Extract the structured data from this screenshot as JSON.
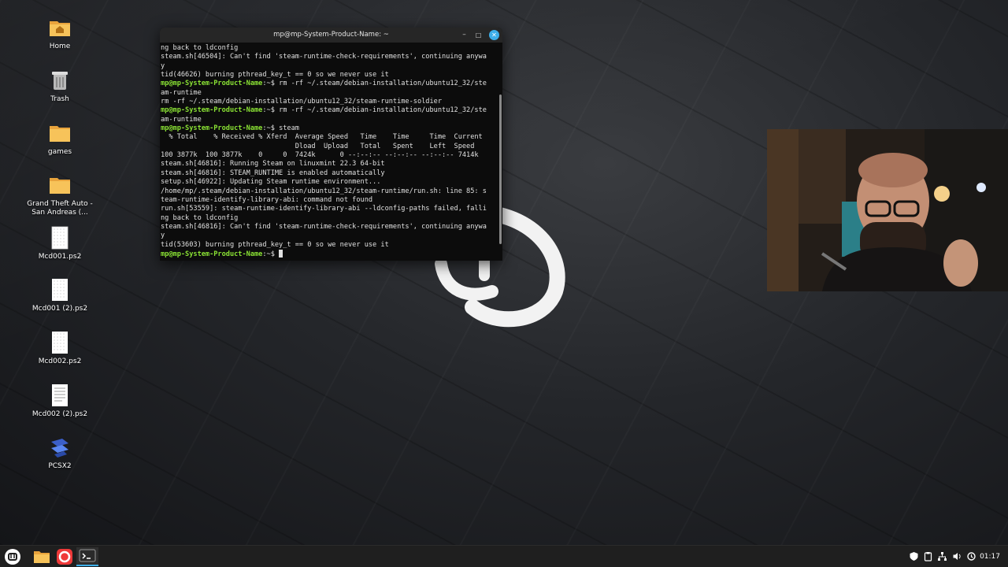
{
  "desktop": {
    "icons": [
      {
        "label": "Home",
        "icon": "home-folder-icon"
      },
      {
        "label": "Trash",
        "icon": "trash-icon"
      },
      {
        "label": "games",
        "icon": "folder-icon"
      },
      {
        "label": "Grand Theft Auto - San Andreas (...",
        "icon": "folder-icon"
      },
      {
        "label": "Mcd001.ps2",
        "icon": "file-icon"
      },
      {
        "label": "Mcd001 (2).ps2",
        "icon": "file-icon"
      },
      {
        "label": "Mcd002.ps2",
        "icon": "file-icon"
      },
      {
        "label": "Mcd002 (2).ps2",
        "icon": "text-file-icon"
      },
      {
        "label": "PCSX2",
        "icon": "pcsx2-icon"
      }
    ]
  },
  "terminal": {
    "title": "mp@mp-System-Product-Name: ~",
    "prompt_user": "mp@mp-System-Product-Name",
    "prompt_suffix": ":~$ ",
    "lines": [
      {
        "text": "ng back to ldconfig"
      },
      {
        "text": "steam.sh[46504]: Can't find 'steam-runtime-check-requirements', continuing anywa"
      },
      {
        "text": "y"
      },
      {
        "text": "tid(46626) burning pthread_key_t == 0 so we never use it"
      },
      {
        "prompt": true,
        "text": "rm -rf ~/.steam/debian-installation/ubuntu12_32/ste"
      },
      {
        "text": "am-runtime"
      },
      {
        "text": "rm -rf ~/.steam/debian-installation/ubuntu12_32/steam-runtime-soldier"
      },
      {
        "prompt": true,
        "text": "rm -rf ~/.steam/debian-installation/ubuntu12_32/ste"
      },
      {
        "text": "am-runtime"
      },
      {
        "prompt": true,
        "text": "steam"
      },
      {
        "text": "  % Total    % Received % Xferd  Average Speed   Time    Time     Time  Current"
      },
      {
        "text": "                                 Dload  Upload   Total   Spent    Left  Speed"
      },
      {
        "text": "100 3877k  100 3877k    0     0  7424k      0 --:--:-- --:--:-- --:--:-- 7414k"
      },
      {
        "text": "steam.sh[46816]: Running Steam on linuxmint 22.3 64-bit"
      },
      {
        "text": "steam.sh[46816]: STEAM_RUNTIME is enabled automatically"
      },
      {
        "text": "setup.sh[46922]: Updating Steam runtime environment..."
      },
      {
        "text": "/home/mp/.steam/debian-installation/ubuntu12_32/steam-runtime/run.sh: line 85: s"
      },
      {
        "text": "team-runtime-identify-library-abi: command not found"
      },
      {
        "text": "run.sh[53559]: steam-runtime-identify-library-abi --ldconfig-paths failed, falli"
      },
      {
        "text": "ng back to ldconfig"
      },
      {
        "text": "steam.sh[46816]: Can't find 'steam-runtime-check-requirements', continuing anywa"
      },
      {
        "text": "y"
      },
      {
        "text": "tid(53603) burning pthread_key_t == 0 so we never use it"
      },
      {
        "prompt": true,
        "text": "",
        "cursor": true
      }
    ]
  },
  "taskbar": {
    "items": [
      {
        "name": "mint-menu-button",
        "icon": "linux-mint-logo-icon"
      },
      {
        "name": "files-launcher",
        "icon": "folder-icon"
      },
      {
        "name": "browser-launcher",
        "icon": "vivaldi-icon"
      },
      {
        "name": "terminal-task",
        "icon": "terminal-icon"
      }
    ],
    "tray": [
      "shield-icon",
      "clipboard-icon",
      "network-icon",
      "volume-icon",
      "update-icon"
    ],
    "clock": "01:17"
  },
  "colors": {
    "accent": "#3daee9",
    "prompt_green": "#8ae234",
    "prompt_blue": "#729fcf"
  }
}
